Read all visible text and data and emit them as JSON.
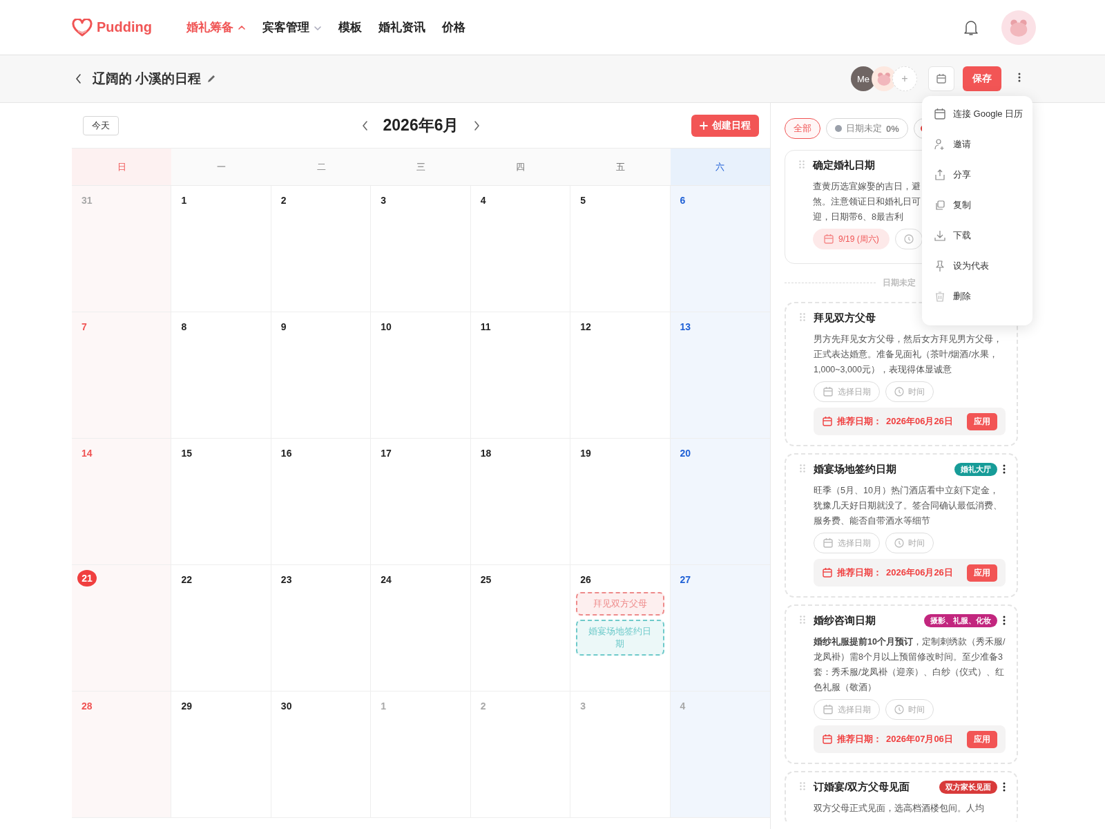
{
  "nav": {
    "brand": "Pudding",
    "items": [
      {
        "label": "婚礼筹备",
        "selected": true,
        "has_dropdown": true,
        "expanded": true
      },
      {
        "label": "宾客管理",
        "selected": false,
        "has_dropdown": true,
        "expanded": false
      },
      {
        "label": "模板",
        "selected": false,
        "has_dropdown": false
      },
      {
        "label": "婚礼资讯",
        "selected": false,
        "has_dropdown": false
      },
      {
        "label": "价格",
        "selected": false,
        "has_dropdown": false
      }
    ]
  },
  "subheader": {
    "title": "辽阔的 小溪的日程",
    "members": [
      {
        "kind": "me",
        "label": "Me"
      },
      {
        "kind": "bear"
      },
      {
        "kind": "add",
        "label": "+"
      }
    ],
    "save": "保存"
  },
  "calendar": {
    "today_button": "今天",
    "month": "2026年6月",
    "create_button": "创建日程",
    "weekdays": [
      {
        "label": "日",
        "kind": "sun"
      },
      {
        "label": "一",
        "kind": "weekday"
      },
      {
        "label": "二",
        "kind": "weekday"
      },
      {
        "label": "三",
        "kind": "weekday"
      },
      {
        "label": "四",
        "kind": "weekday"
      },
      {
        "label": "五",
        "kind": "weekday"
      },
      {
        "label": "六",
        "kind": "sat"
      }
    ],
    "weeks": [
      [
        {
          "day": "31",
          "other_month": true,
          "today": false
        },
        {
          "day": "1",
          "other_month": false,
          "today": false
        },
        {
          "day": "2",
          "other_month": false,
          "today": false
        },
        {
          "day": "3",
          "other_month": false,
          "today": false
        },
        {
          "day": "4",
          "other_month": false,
          "today": false
        },
        {
          "day": "5",
          "other_month": false,
          "today": false
        },
        {
          "day": "6",
          "other_month": false,
          "today": false
        }
      ],
      [
        {
          "day": "7",
          "other_month": false,
          "today": false
        },
        {
          "day": "8",
          "other_month": false,
          "today": false
        },
        {
          "day": "9",
          "other_month": false,
          "today": false
        },
        {
          "day": "10",
          "other_month": false,
          "today": false
        },
        {
          "day": "11",
          "other_month": false,
          "today": false
        },
        {
          "day": "12",
          "other_month": false,
          "today": false
        },
        {
          "day": "13",
          "other_month": false,
          "today": false
        }
      ],
      [
        {
          "day": "14",
          "other_month": false,
          "today": false
        },
        {
          "day": "15",
          "other_month": false,
          "today": false
        },
        {
          "day": "16",
          "other_month": false,
          "today": false
        },
        {
          "day": "17",
          "other_month": false,
          "today": false
        },
        {
          "day": "18",
          "other_month": false,
          "today": false
        },
        {
          "day": "19",
          "other_month": false,
          "today": false
        },
        {
          "day": "20",
          "other_month": false,
          "today": false
        }
      ],
      [
        {
          "day": "21",
          "other_month": false,
          "today": true
        },
        {
          "day": "22",
          "other_month": false,
          "today": false
        },
        {
          "day": "23",
          "other_month": false,
          "today": false
        },
        {
          "day": "24",
          "other_month": false,
          "today": false
        },
        {
          "day": "25",
          "other_month": false,
          "today": false
        },
        {
          "day": "26",
          "other_month": false,
          "today": false,
          "events": [
            {
              "title": "拜见双方父母",
              "color": "#ee8a8a"
            },
            {
              "title": "婚宴场地签约日期",
              "color": "#6ecaca"
            }
          ]
        },
        {
          "day": "27",
          "other_month": false,
          "today": false
        }
      ],
      [
        {
          "day": "28",
          "other_month": false,
          "today": false
        },
        {
          "day": "29",
          "other_month": false,
          "today": false
        },
        {
          "day": "30",
          "other_month": false,
          "today": false
        },
        {
          "day": "1",
          "other_month": true,
          "today": false
        },
        {
          "day": "2",
          "other_month": true,
          "today": false
        },
        {
          "day": "3",
          "other_month": true,
          "today": false
        },
        {
          "day": "4",
          "other_month": true,
          "today": false
        }
      ]
    ]
  },
  "filters": [
    {
      "label": "全部",
      "selected": true
    },
    {
      "label": "日期未定",
      "percent": "0%",
      "color": "#9aa0aa",
      "selected": false
    },
    {
      "color": "#e53935",
      "selected": false
    }
  ],
  "tasks": [
    {
      "kind": "scheduled",
      "title": "确定婚礼日期",
      "description_lines": [
        "查黄历选宜嫁娶的吉日，避",
        "煞。注意领证日和婚礼日可",
        "迎，日期带6、8最吉利"
      ],
      "date": "9/19 (周六)"
    },
    {
      "kind": "divider",
      "label": "日期未定"
    },
    {
      "kind": "unscheduled",
      "title": "拜见双方父母",
      "description": "男方先拜见女方父母，然后女方拜见男方父母，正式表达婚意。准备见面礼（茶叶/烟酒/水果，1,000~3,000元），表现得体显诚意",
      "date_placeholder": "选择日期",
      "time_placeholder": "时间",
      "recommend": "推荐日期：",
      "recommend_date": "2026年06月26日",
      "apply": "应用"
    },
    {
      "kind": "unscheduled",
      "title": "婚宴场地签约日期",
      "tag": {
        "text": "婚礼大厅",
        "color": "#179c98"
      },
      "description": "旺季（5月、10月）热门酒店看中立刻下定金，犹豫几天好日期就没了。签合同确认最低消费、服务费、能否自带酒水等细节",
      "date_placeholder": "选择日期",
      "time_placeholder": "时间",
      "recommend": "推荐日期：",
      "recommend_date": "2026年06月26日",
      "apply": "应用",
      "menu": true
    },
    {
      "kind": "unscheduled",
      "title": "婚纱咨询日期",
      "tag": {
        "text": "摄影、礼服、化妆",
        "color": "#c2267e"
      },
      "description": "**婚纱礼服提前10个月预订**，定制刺绣款（秀禾服/龙凤褂）需8个月以上预留修改时间。至少准备3套：秀禾服/龙凤褂（迎亲）、白纱（仪式）、红色礼服（敬酒）",
      "date_placeholder": "选择日期",
      "time_placeholder": "时间",
      "recommend": "推荐日期：",
      "recommend_date": "2026年07月06日",
      "apply": "应用",
      "menu": true
    },
    {
      "kind": "unscheduled",
      "title": "订婚宴/双方父母见面",
      "tag": {
        "text": "双方家长见面",
        "color": "#d83a3a"
      },
      "description": "双方父母正式见面，选高档酒楼包间。人均",
      "menu": true
    }
  ],
  "menu": {
    "items": [
      {
        "label": "连接 Google 日历"
      },
      {
        "label": "邀请"
      },
      {
        "label": "分享"
      },
      {
        "label": "复制"
      },
      {
        "label": "下载"
      },
      {
        "label": "设为代表"
      },
      {
        "label": "删除"
      }
    ]
  }
}
